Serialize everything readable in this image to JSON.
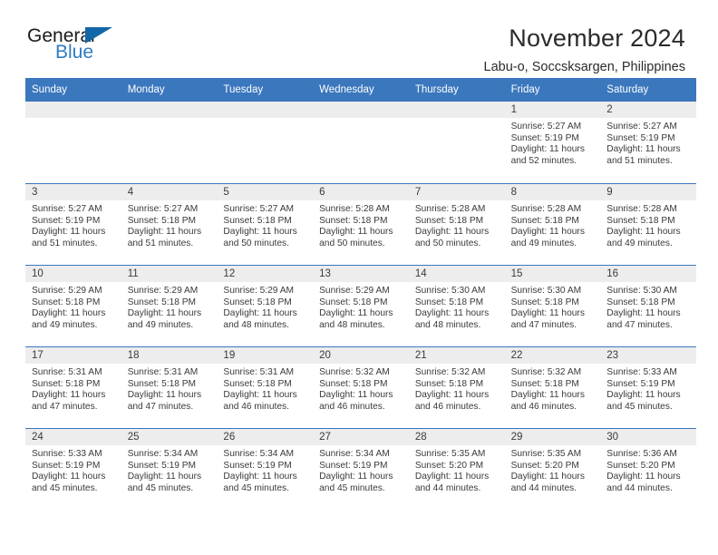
{
  "logo": {
    "word_general": "General",
    "word_blue": "Blue",
    "triangle_color": "#1267a8",
    "blue_color": "#2b7cc4"
  },
  "header": {
    "month_title": "November 2024",
    "location": "Labu-o, Soccsksargen, Philippines"
  },
  "theme": {
    "header_blue": "#3b77bd",
    "day_band_gray": "#ededed",
    "text": "#3a3a3a"
  },
  "calendar": {
    "weekdays": [
      "Sunday",
      "Monday",
      "Tuesday",
      "Wednesday",
      "Thursday",
      "Friday",
      "Saturday"
    ],
    "weeks": [
      [
        {
          "day": "",
          "empty": true
        },
        {
          "day": "",
          "empty": true
        },
        {
          "day": "",
          "empty": true
        },
        {
          "day": "",
          "empty": true
        },
        {
          "day": "",
          "empty": true
        },
        {
          "day": "1",
          "sunrise": "Sunrise: 5:27 AM",
          "sunset": "Sunset: 5:19 PM",
          "daylight": "Daylight: 11 hours and 52 minutes."
        },
        {
          "day": "2",
          "sunrise": "Sunrise: 5:27 AM",
          "sunset": "Sunset: 5:19 PM",
          "daylight": "Daylight: 11 hours and 51 minutes."
        }
      ],
      [
        {
          "day": "3",
          "sunrise": "Sunrise: 5:27 AM",
          "sunset": "Sunset: 5:19 PM",
          "daylight": "Daylight: 11 hours and 51 minutes."
        },
        {
          "day": "4",
          "sunrise": "Sunrise: 5:27 AM",
          "sunset": "Sunset: 5:18 PM",
          "daylight": "Daylight: 11 hours and 51 minutes."
        },
        {
          "day": "5",
          "sunrise": "Sunrise: 5:27 AM",
          "sunset": "Sunset: 5:18 PM",
          "daylight": "Daylight: 11 hours and 50 minutes."
        },
        {
          "day": "6",
          "sunrise": "Sunrise: 5:28 AM",
          "sunset": "Sunset: 5:18 PM",
          "daylight": "Daylight: 11 hours and 50 minutes."
        },
        {
          "day": "7",
          "sunrise": "Sunrise: 5:28 AM",
          "sunset": "Sunset: 5:18 PM",
          "daylight": "Daylight: 11 hours and 50 minutes."
        },
        {
          "day": "8",
          "sunrise": "Sunrise: 5:28 AM",
          "sunset": "Sunset: 5:18 PM",
          "daylight": "Daylight: 11 hours and 49 minutes."
        },
        {
          "day": "9",
          "sunrise": "Sunrise: 5:28 AM",
          "sunset": "Sunset: 5:18 PM",
          "daylight": "Daylight: 11 hours and 49 minutes."
        }
      ],
      [
        {
          "day": "10",
          "sunrise": "Sunrise: 5:29 AM",
          "sunset": "Sunset: 5:18 PM",
          "daylight": "Daylight: 11 hours and 49 minutes."
        },
        {
          "day": "11",
          "sunrise": "Sunrise: 5:29 AM",
          "sunset": "Sunset: 5:18 PM",
          "daylight": "Daylight: 11 hours and 49 minutes."
        },
        {
          "day": "12",
          "sunrise": "Sunrise: 5:29 AM",
          "sunset": "Sunset: 5:18 PM",
          "daylight": "Daylight: 11 hours and 48 minutes."
        },
        {
          "day": "13",
          "sunrise": "Sunrise: 5:29 AM",
          "sunset": "Sunset: 5:18 PM",
          "daylight": "Daylight: 11 hours and 48 minutes."
        },
        {
          "day": "14",
          "sunrise": "Sunrise: 5:30 AM",
          "sunset": "Sunset: 5:18 PM",
          "daylight": "Daylight: 11 hours and 48 minutes."
        },
        {
          "day": "15",
          "sunrise": "Sunrise: 5:30 AM",
          "sunset": "Sunset: 5:18 PM",
          "daylight": "Daylight: 11 hours and 47 minutes."
        },
        {
          "day": "16",
          "sunrise": "Sunrise: 5:30 AM",
          "sunset": "Sunset: 5:18 PM",
          "daylight": "Daylight: 11 hours and 47 minutes."
        }
      ],
      [
        {
          "day": "17",
          "sunrise": "Sunrise: 5:31 AM",
          "sunset": "Sunset: 5:18 PM",
          "daylight": "Daylight: 11 hours and 47 minutes."
        },
        {
          "day": "18",
          "sunrise": "Sunrise: 5:31 AM",
          "sunset": "Sunset: 5:18 PM",
          "daylight": "Daylight: 11 hours and 47 minutes."
        },
        {
          "day": "19",
          "sunrise": "Sunrise: 5:31 AM",
          "sunset": "Sunset: 5:18 PM",
          "daylight": "Daylight: 11 hours and 46 minutes."
        },
        {
          "day": "20",
          "sunrise": "Sunrise: 5:32 AM",
          "sunset": "Sunset: 5:18 PM",
          "daylight": "Daylight: 11 hours and 46 minutes."
        },
        {
          "day": "21",
          "sunrise": "Sunrise: 5:32 AM",
          "sunset": "Sunset: 5:18 PM",
          "daylight": "Daylight: 11 hours and 46 minutes."
        },
        {
          "day": "22",
          "sunrise": "Sunrise: 5:32 AM",
          "sunset": "Sunset: 5:18 PM",
          "daylight": "Daylight: 11 hours and 46 minutes."
        },
        {
          "day": "23",
          "sunrise": "Sunrise: 5:33 AM",
          "sunset": "Sunset: 5:19 PM",
          "daylight": "Daylight: 11 hours and 45 minutes."
        }
      ],
      [
        {
          "day": "24",
          "sunrise": "Sunrise: 5:33 AM",
          "sunset": "Sunset: 5:19 PM",
          "daylight": "Daylight: 11 hours and 45 minutes."
        },
        {
          "day": "25",
          "sunrise": "Sunrise: 5:34 AM",
          "sunset": "Sunset: 5:19 PM",
          "daylight": "Daylight: 11 hours and 45 minutes."
        },
        {
          "day": "26",
          "sunrise": "Sunrise: 5:34 AM",
          "sunset": "Sunset: 5:19 PM",
          "daylight": "Daylight: 11 hours and 45 minutes."
        },
        {
          "day": "27",
          "sunrise": "Sunrise: 5:34 AM",
          "sunset": "Sunset: 5:19 PM",
          "daylight": "Daylight: 11 hours and 45 minutes."
        },
        {
          "day": "28",
          "sunrise": "Sunrise: 5:35 AM",
          "sunset": "Sunset: 5:20 PM",
          "daylight": "Daylight: 11 hours and 44 minutes."
        },
        {
          "day": "29",
          "sunrise": "Sunrise: 5:35 AM",
          "sunset": "Sunset: 5:20 PM",
          "daylight": "Daylight: 11 hours and 44 minutes."
        },
        {
          "day": "30",
          "sunrise": "Sunrise: 5:36 AM",
          "sunset": "Sunset: 5:20 PM",
          "daylight": "Daylight: 11 hours and 44 minutes."
        }
      ]
    ]
  }
}
